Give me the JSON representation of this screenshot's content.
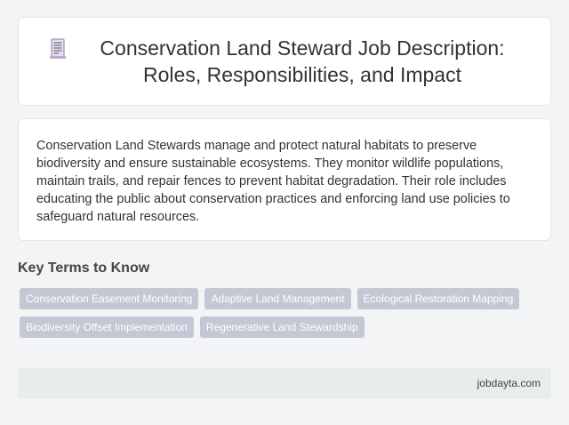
{
  "header": {
    "icon": "document-icon",
    "title": "Conservation Land Steward Job Description: Roles, Responsibilities, and Impact"
  },
  "description": "Conservation Land Stewards manage and protect natural habitats to preserve biodiversity and ensure sustainable ecosystems. They monitor wildlife populations, maintain trails, and repair fences to prevent habitat degradation. Their role includes educating the public about conservation practices and enforcing land use policies to safeguard natural resources.",
  "key_terms": {
    "heading": "Key Terms to Know",
    "tags": [
      "Conservation Easement Monitoring",
      "Adaptive Land Management",
      "Ecological Restoration Mapping",
      "Biodiversity Offset Implementation",
      "Regenerative Land Stewardship"
    ]
  },
  "footer": {
    "site": "jobdayta.com"
  },
  "colors": {
    "tag_bg": "#c4c8d4",
    "footer_bg": "#e8ecec",
    "page_bg": "#f3f4f6"
  }
}
